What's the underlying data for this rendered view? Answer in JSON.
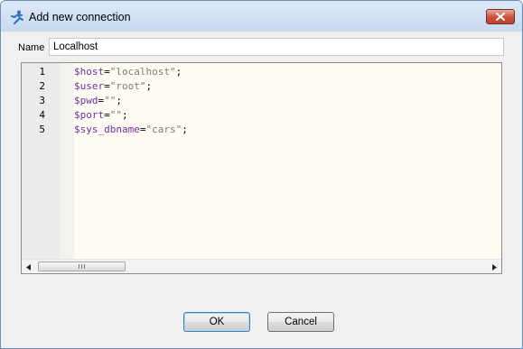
{
  "window": {
    "title": "Add new connection"
  },
  "form": {
    "name_label": "Name",
    "name_value": "Localhost"
  },
  "editor": {
    "lines": [
      {
        "num": "1",
        "var": "$host",
        "eq": "=",
        "str": "\"localhost\"",
        "semi": ";"
      },
      {
        "num": "2",
        "var": "$user",
        "eq": "=",
        "str": "\"root\"",
        "semi": ";"
      },
      {
        "num": "3",
        "var": "$pwd",
        "eq": "=",
        "str": "\"\"",
        "semi": ";"
      },
      {
        "num": "4",
        "var": "$port",
        "eq": "=",
        "str": "\"\"",
        "semi": ";"
      },
      {
        "num": "5",
        "var": "$sys_dbname",
        "eq": "=",
        "str": "\"cars\"",
        "semi": ";"
      }
    ]
  },
  "buttons": {
    "ok": "OK",
    "cancel": "Cancel"
  },
  "icons": {
    "title": "connection-icon",
    "close": "close-icon",
    "scroll_left": "arrow-left-icon",
    "scroll_right": "arrow-right-icon"
  },
  "colors": {
    "variable": "#6a2fa6",
    "string": "#7a7a7a",
    "editor_bg": "#fffcf3",
    "title_bar": "#c7daf0",
    "close_button": "#c6503a"
  }
}
